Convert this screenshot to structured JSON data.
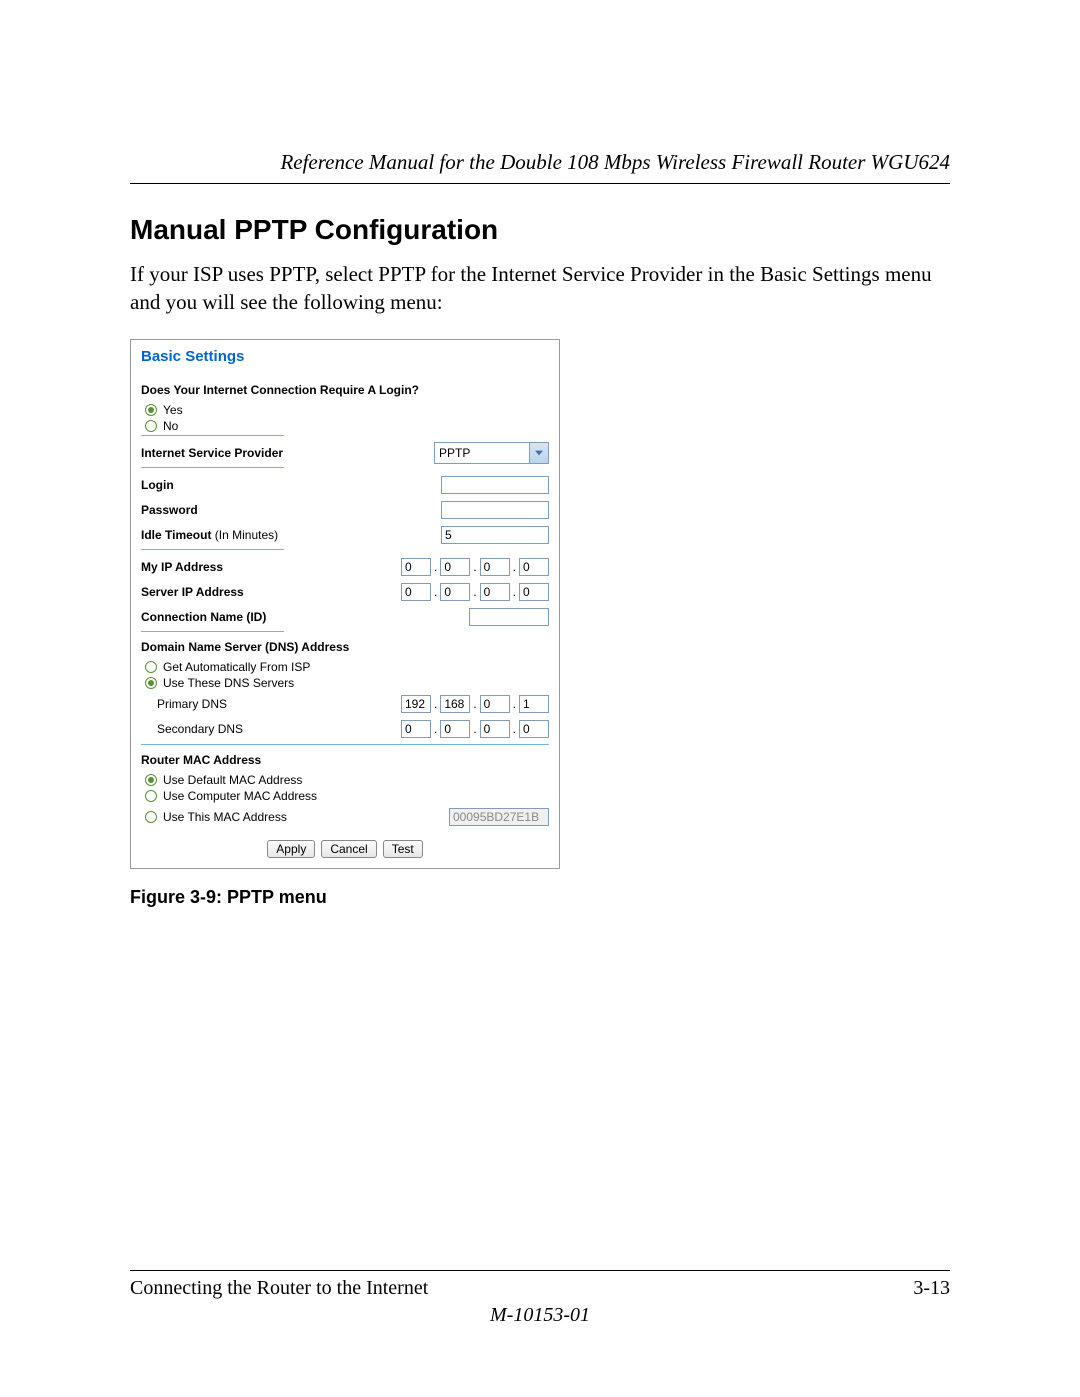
{
  "header": {
    "running": "Reference Manual for the Double 108 Mbps Wireless Firewall Router WGU624"
  },
  "section": {
    "title": "Manual PPTP Configuration",
    "body": "If your ISP uses PPTP, select PPTP for the Internet Service Provider in the Basic Settings menu and you will see the following menu:"
  },
  "figure": {
    "caption": "Figure 3-9:  PPTP menu"
  },
  "panel": {
    "title": "Basic Settings",
    "login_question": "Does Your Internet Connection Require A Login?",
    "login_yes": "Yes",
    "login_no": "No",
    "login_selected": "yes",
    "isp_label": "Internet Service Provider",
    "isp_value": "PPTP",
    "login_label": "Login",
    "login_value": "",
    "password_label": "Password",
    "password_value": "",
    "idle_label_bold": "Idle Timeout",
    "idle_label_note": " (In Minutes)",
    "idle_value": "5",
    "myip_label": "My IP Address",
    "myip": [
      "0",
      "0",
      "0",
      "0"
    ],
    "serverip_label": "Server IP Address",
    "serverip": [
      "0",
      "0",
      "0",
      "0"
    ],
    "conn_label": "Connection Name (ID)",
    "conn_value": "",
    "dns_heading": "Domain Name Server (DNS) Address",
    "dns_auto_label": "Get Automatically From ISP",
    "dns_use_label": "Use These DNS Servers",
    "dns_selected": "use",
    "primary_dns_label": "Primary DNS",
    "primary_dns": [
      "192",
      "168",
      "0",
      "1"
    ],
    "secondary_dns_label": "Secondary DNS",
    "secondary_dns": [
      "0",
      "0",
      "0",
      "0"
    ],
    "mac_heading": "Router MAC Address",
    "mac_default_label": "Use Default MAC Address",
    "mac_computer_label": "Use Computer MAC Address",
    "mac_this_label": "Use This MAC Address",
    "mac_selected": "default",
    "mac_value": "00095BD27E1B",
    "apply": "Apply",
    "cancel": "Cancel",
    "test": "Test"
  },
  "footer": {
    "chapter": "Connecting the Router to the Internet",
    "page": "3-13",
    "doc": "M-10153-01"
  }
}
